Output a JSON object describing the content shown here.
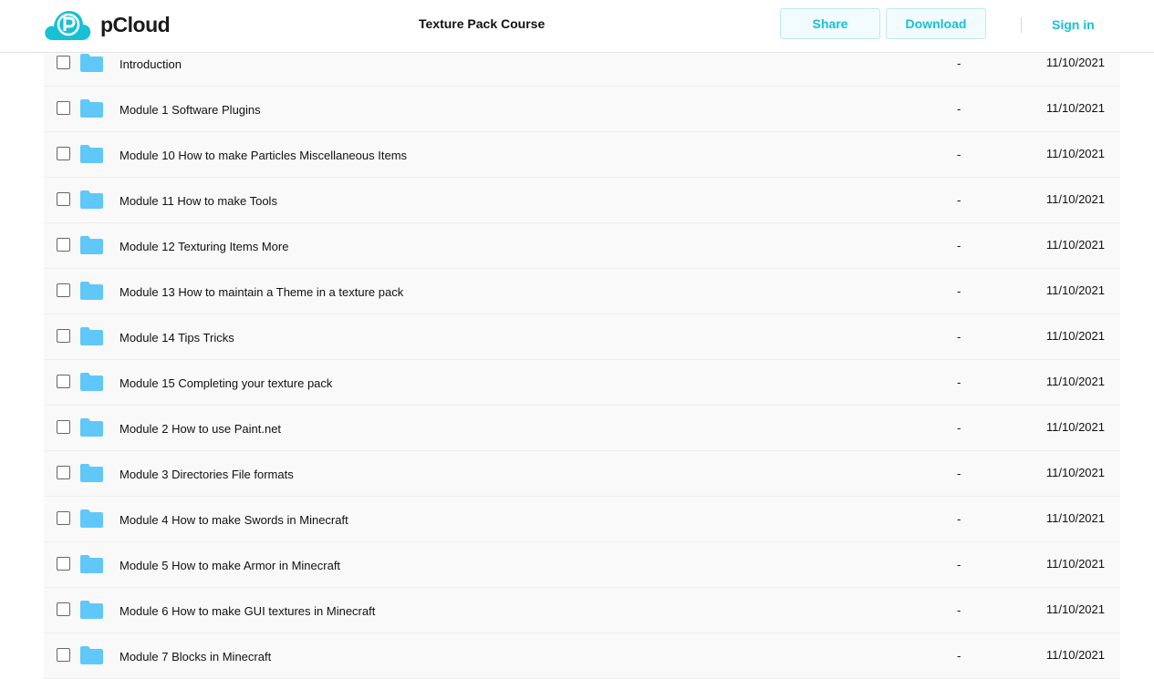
{
  "header": {
    "logo_text": "pCloud",
    "title": "Texture Pack Course",
    "share_label": "Share",
    "download_label": "Download",
    "signin_label": "Sign in",
    "accent_color": "#17c1d3"
  },
  "files": [
    {
      "name": "Introduction",
      "size": "-",
      "date": "11/10/2021"
    },
    {
      "name": "Module 1 Software Plugins",
      "size": "-",
      "date": "11/10/2021"
    },
    {
      "name": "Module 10 How to make Particles Miscellaneous Items",
      "size": "-",
      "date": "11/10/2021"
    },
    {
      "name": "Module 11 How to make Tools",
      "size": "-",
      "date": "11/10/2021"
    },
    {
      "name": "Module 12 Texturing Items More",
      "size": "-",
      "date": "11/10/2021"
    },
    {
      "name": "Module 13 How to maintain a Theme in a texture pack",
      "size": "-",
      "date": "11/10/2021"
    },
    {
      "name": "Module 14 Tips Tricks",
      "size": "-",
      "date": "11/10/2021"
    },
    {
      "name": "Module 15 Completing your texture pack",
      "size": "-",
      "date": "11/10/2021"
    },
    {
      "name": "Module 2 How to use Paint.net",
      "size": "-",
      "date": "11/10/2021"
    },
    {
      "name": "Module 3 Directories File formats",
      "size": "-",
      "date": "11/10/2021"
    },
    {
      "name": "Module 4 How to make Swords in Minecraft",
      "size": "-",
      "date": "11/10/2021"
    },
    {
      "name": "Module 5 How to make Armor in Minecraft",
      "size": "-",
      "date": "11/10/2021"
    },
    {
      "name": "Module 6 How to make GUI textures in Minecraft",
      "size": "-",
      "date": "11/10/2021"
    },
    {
      "name": "Module 7 Blocks in Minecraft",
      "size": "-",
      "date": "11/10/2021"
    }
  ]
}
